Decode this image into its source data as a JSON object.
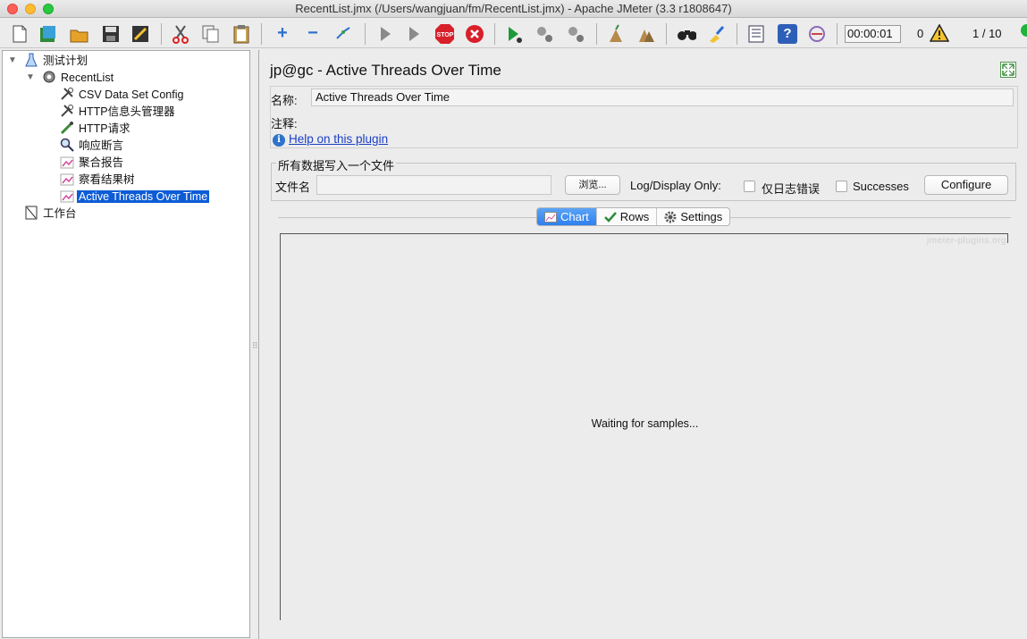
{
  "window": {
    "title": "RecentList.jmx (/Users/wangjuan/fm/RecentList.jmx) - Apache JMeter (3.3 r1808647)"
  },
  "toolbar": {
    "buttons": [
      {
        "icon": "new-icon"
      },
      {
        "icon": "templates-icon"
      },
      {
        "icon": "open-icon"
      },
      {
        "icon": "save-icon"
      },
      {
        "icon": "save-as-icon"
      },
      {
        "icon": "cut-icon"
      },
      {
        "icon": "copy-icon"
      },
      {
        "icon": "paste-icon"
      },
      {
        "icon": "expand-all-icon"
      },
      {
        "icon": "collapse-all-icon"
      },
      {
        "icon": "toggle-icon"
      },
      {
        "icon": "start-icon"
      },
      {
        "icon": "start-no-pauses-icon"
      },
      {
        "icon": "stop-icon"
      },
      {
        "icon": "shutdown-icon"
      },
      {
        "icon": "remote-start-icon"
      },
      {
        "icon": "remote-stop-icon"
      },
      {
        "icon": "remote-shutdown-icon"
      },
      {
        "icon": "clear-icon"
      },
      {
        "icon": "clear-all-icon"
      },
      {
        "icon": "search-icon"
      },
      {
        "icon": "reset-search-icon"
      },
      {
        "icon": "function-helper-icon"
      },
      {
        "icon": "help-icon"
      },
      {
        "icon": "logger-icon"
      }
    ],
    "elapsed_time": "00:00:01",
    "error_count": "0",
    "threads": "1 / 10"
  },
  "tree": {
    "nodes": [
      {
        "label": "测试计划",
        "icon": "test-plan-icon",
        "expanded": true
      },
      {
        "label": "RecentList",
        "icon": "thread-group-icon",
        "expanded": true
      },
      {
        "label": "CSV Data Set Config",
        "icon": "config-wrench-icon"
      },
      {
        "label": "HTTP信息头管理器",
        "icon": "config-wrench-icon"
      },
      {
        "label": "HTTP请求",
        "icon": "sampler-pipette-icon"
      },
      {
        "label": "响应断言",
        "icon": "assertion-magnifier-icon"
      },
      {
        "label": "聚合报告",
        "icon": "listener-chart-icon"
      },
      {
        "label": "察看结果树",
        "icon": "listener-chart-icon"
      },
      {
        "label": "Active Threads Over Time",
        "icon": "listener-chart-icon",
        "selected": true
      },
      {
        "label": "工作台",
        "icon": "workbench-icon"
      }
    ]
  },
  "panel": {
    "title": "jp@gc - Active Threads Over Time",
    "name_label": "名称:",
    "name_value": "Active Threads Over Time",
    "comment_label": "注释:",
    "help_link": "Help on this plugin",
    "file_section_title": "所有数据写入一个文件",
    "file_label": "文件名",
    "file_value": "",
    "browse_button": "浏览...",
    "log_display_label": "Log/Display Only:",
    "errors_only_label": "仅日志错误",
    "errors_only_checked": false,
    "successes_label": "Successes",
    "successes_checked": false,
    "configure_button": "Configure",
    "tabs": [
      {
        "label": "Chart",
        "icon": "chart-icon",
        "active": true
      },
      {
        "label": "Rows",
        "icon": "checkmark-icon",
        "active": false
      },
      {
        "label": "Settings",
        "icon": "gear-icon",
        "active": false
      }
    ],
    "watermark": "jmeter-plugins.org",
    "waiting_text": "Waiting for samples..."
  },
  "colors": {
    "selection": "#0d5cd6",
    "tab_active": "#2f7ff0",
    "link": "#1a3fc4"
  }
}
